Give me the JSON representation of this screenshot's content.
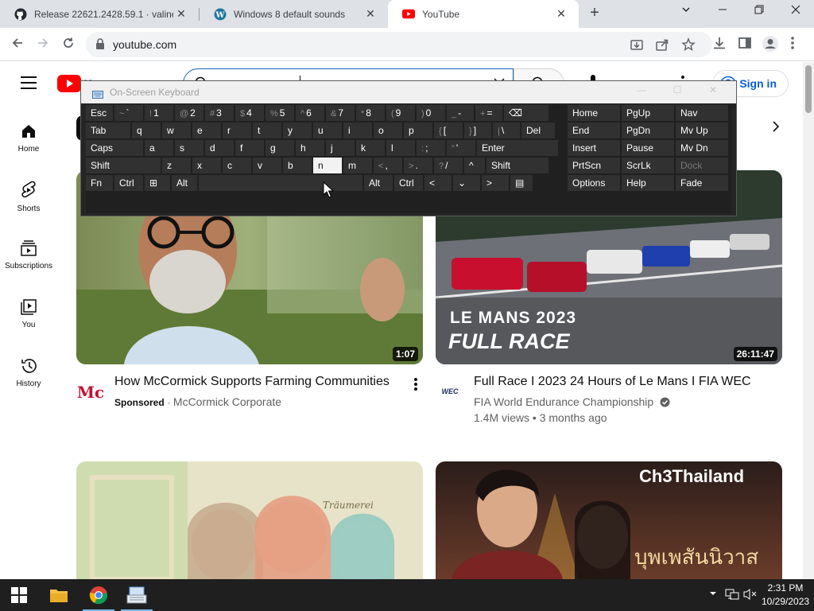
{
  "browser": {
    "tabs": [
      {
        "title": "Release 22621.2428.59.1 · valinet",
        "icon": "github-icon",
        "active": false
      },
      {
        "title": "Windows 8 default sounds",
        "icon": "wordpress-icon",
        "active": false
      },
      {
        "title": "YouTube",
        "icon": "youtube-icon",
        "active": true
      }
    ],
    "new_tab": "+",
    "window_controls": {
      "dropdown": "⌄",
      "minimize": "—",
      "restore": "❐",
      "close": "✕"
    },
    "url": "youtube.com"
  },
  "youtube": {
    "sign_in": "Sign in",
    "sidebar": [
      {
        "label": "Home",
        "icon": "home-icon"
      },
      {
        "label": "Shorts",
        "icon": "shorts-icon"
      },
      {
        "label": "Subscriptions",
        "icon": "subscriptions-icon"
      },
      {
        "label": "You",
        "icon": "you-icon"
      },
      {
        "label": "History",
        "icon": "history-icon"
      }
    ],
    "videos": [
      {
        "title": "How McCormick Supports Farming Communities",
        "duration": "1:07",
        "sponsored": "Sponsored",
        "channel": "McCormick Corporate",
        "meta": ""
      },
      {
        "title": "Full Race I 2023 24 Hours of Le Mans I FIA WEC",
        "duration": "26:11:47",
        "channel": "FIA World Endurance Championship",
        "meta": "1.4M views • 3 months ago",
        "thumb_text1": "LE MANS 2023",
        "thumb_text2": "FULL RACE"
      },
      {
        "title": "",
        "thumb_text": "Träumerei"
      },
      {
        "title": "",
        "thumb_text1": "Ch3Thailand",
        "thumb_text2": "บุพเพสันนิวาส"
      }
    ]
  },
  "osk": {
    "title": "On-Screen Keyboard",
    "rows": [
      [
        {
          "s": "",
          "m": "Esc"
        },
        {
          "s": "~",
          "m": "`"
        },
        {
          "s": "!",
          "m": "1"
        },
        {
          "s": "@",
          "m": "2"
        },
        {
          "s": "#",
          "m": "3"
        },
        {
          "s": "$",
          "m": "4"
        },
        {
          "s": "%",
          "m": "5"
        },
        {
          "s": "^",
          "m": "6"
        },
        {
          "s": "&",
          "m": "7"
        },
        {
          "s": "*",
          "m": "8"
        },
        {
          "s": "(",
          "m": "9"
        },
        {
          "s": ")",
          "m": "0"
        },
        {
          "s": "_",
          "m": "-"
        },
        {
          "s": "+",
          "m": "="
        },
        {
          "s": "",
          "m": "⌫"
        }
      ],
      [
        {
          "s": "",
          "m": "Tab"
        },
        {
          "s": "",
          "m": "q"
        },
        {
          "s": "",
          "m": "w"
        },
        {
          "s": "",
          "m": "e"
        },
        {
          "s": "",
          "m": "r"
        },
        {
          "s": "",
          "m": "t"
        },
        {
          "s": "",
          "m": "y"
        },
        {
          "s": "",
          "m": "u"
        },
        {
          "s": "",
          "m": "i"
        },
        {
          "s": "",
          "m": "o"
        },
        {
          "s": "",
          "m": "p"
        },
        {
          "s": "{",
          "m": "["
        },
        {
          "s": "}",
          "m": "]"
        },
        {
          "s": "|",
          "m": "\\"
        },
        {
          "s": "",
          "m": "Del"
        }
      ],
      [
        {
          "s": "",
          "m": "Caps"
        },
        {
          "s": "",
          "m": "a"
        },
        {
          "s": "",
          "m": "s"
        },
        {
          "s": "",
          "m": "d"
        },
        {
          "s": "",
          "m": "f"
        },
        {
          "s": "",
          "m": "g"
        },
        {
          "s": "",
          "m": "h"
        },
        {
          "s": "",
          "m": "j"
        },
        {
          "s": "",
          "m": "k"
        },
        {
          "s": "",
          "m": "l"
        },
        {
          "s": ":",
          "m": ";"
        },
        {
          "s": "\"",
          "m": "'"
        },
        {
          "s": "",
          "m": "Enter"
        }
      ],
      [
        {
          "s": "",
          "m": "Shift"
        },
        {
          "s": "",
          "m": "z"
        },
        {
          "s": "",
          "m": "x"
        },
        {
          "s": "",
          "m": "c"
        },
        {
          "s": "",
          "m": "v"
        },
        {
          "s": "",
          "m": "b"
        },
        {
          "s": "",
          "m": "n"
        },
        {
          "s": "",
          "m": "m"
        },
        {
          "s": "<",
          "m": ","
        },
        {
          "s": ">",
          "m": "."
        },
        {
          "s": "?",
          "m": "/"
        },
        {
          "s": "",
          "m": "^"
        },
        {
          "s": "",
          "m": "Shift"
        }
      ],
      [
        {
          "s": "",
          "m": "Fn"
        },
        {
          "s": "",
          "m": "Ctrl"
        },
        {
          "s": "",
          "m": "⊞"
        },
        {
          "s": "",
          "m": "Alt"
        },
        {
          "s": "",
          "m": ""
        },
        {
          "s": "",
          "m": "Alt"
        },
        {
          "s": "",
          "m": "Ctrl"
        },
        {
          "s": "",
          "m": "<"
        },
        {
          "s": "",
          "m": "⌄"
        },
        {
          "s": "",
          "m": ">"
        },
        {
          "s": "",
          "m": "▤"
        }
      ]
    ],
    "nav_keys": [
      [
        "Home",
        "PgUp",
        "Nav"
      ],
      [
        "End",
        "PgDn",
        "Mv Up"
      ],
      [
        "Insert",
        "Pause",
        "Mv Dn"
      ],
      [
        "PrtScn",
        "ScrLk",
        "Dock"
      ],
      [
        "Options",
        "Help",
        "Fade"
      ]
    ]
  },
  "taskbar": {
    "time": "2:31 PM",
    "date": "10/29/2023"
  }
}
